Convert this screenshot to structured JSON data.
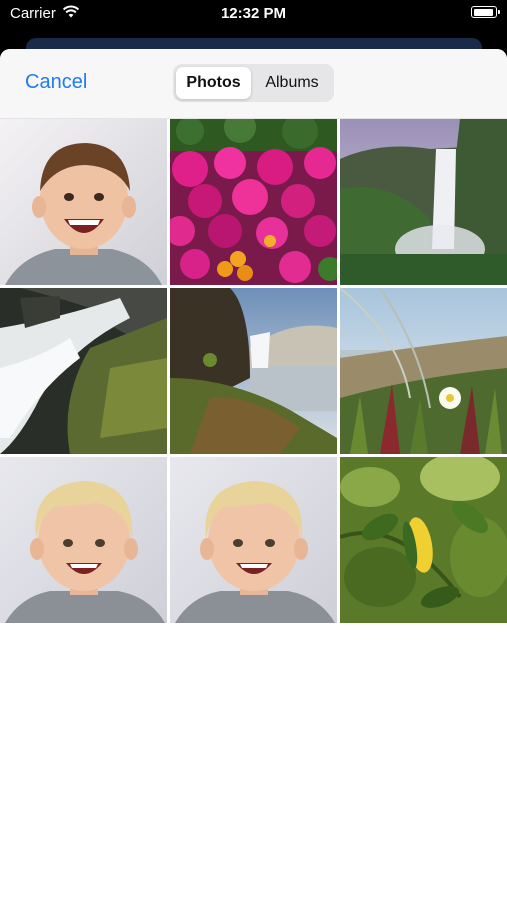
{
  "status_bar": {
    "carrier": "Carrier",
    "time": "12:32 PM"
  },
  "picker": {
    "cancel_label": "Cancel",
    "segments": [
      {
        "label": "Photos",
        "selected": true
      },
      {
        "label": "Albums",
        "selected": false
      }
    ]
  },
  "grid": {
    "columns": 3,
    "photos": [
      {
        "subject": "smiling boy with brown hair"
      },
      {
        "subject": "pink and orange flowers"
      },
      {
        "subject": "waterfall on green cliff"
      },
      {
        "subject": "white water over mossy rocks"
      },
      {
        "subject": "waterfall at rocky coast"
      },
      {
        "subject": "grass and white flower by the sea"
      },
      {
        "subject": "smiling blond boy"
      },
      {
        "subject": "smiling blond boy"
      },
      {
        "subject": "green leaves with yellow leaf"
      }
    ]
  },
  "colors": {
    "accent": "#1f7bf6",
    "nav_background": "#f7f7f7",
    "segment_background": "#e6e6e8"
  }
}
